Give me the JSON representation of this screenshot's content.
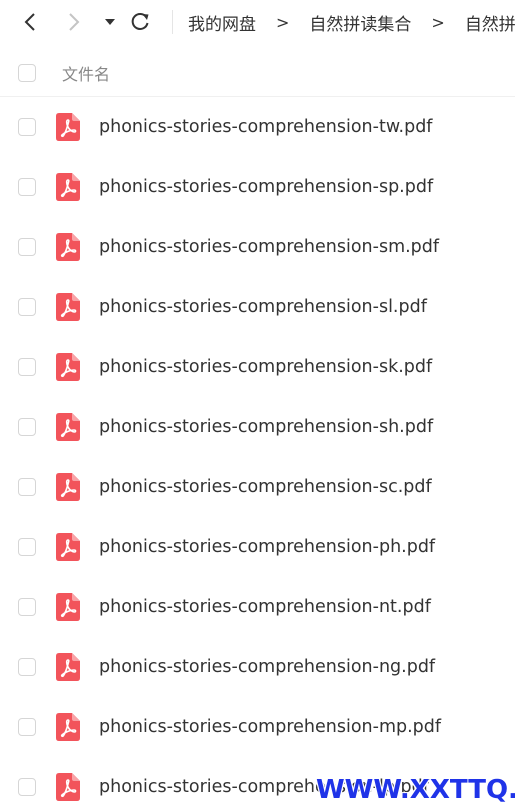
{
  "toolbar": {
    "breadcrumbs": [
      "我的网盘",
      "自然拼读集合",
      "自然拼"
    ],
    "separator": ">"
  },
  "header": {
    "column_label": "文件名"
  },
  "files": [
    {
      "name": "phonics-stories-comprehension-tw.pdf",
      "icon": "pdf-icon"
    },
    {
      "name": "phonics-stories-comprehension-sp.pdf",
      "icon": "pdf-icon"
    },
    {
      "name": "phonics-stories-comprehension-sm.pdf",
      "icon": "pdf-icon"
    },
    {
      "name": "phonics-stories-comprehension-sl.pdf",
      "icon": "pdf-icon"
    },
    {
      "name": "phonics-stories-comprehension-sk.pdf",
      "icon": "pdf-icon"
    },
    {
      "name": "phonics-stories-comprehension-sh.pdf",
      "icon": "pdf-icon"
    },
    {
      "name": "phonics-stories-comprehension-sc.pdf",
      "icon": "pdf-icon"
    },
    {
      "name": "phonics-stories-comprehension-ph.pdf",
      "icon": "pdf-icon"
    },
    {
      "name": "phonics-stories-comprehension-nt.pdf",
      "icon": "pdf-icon"
    },
    {
      "name": "phonics-stories-comprehension-ng.pdf",
      "icon": "pdf-icon"
    },
    {
      "name": "phonics-stories-comprehension-mp.pdf",
      "icon": "pdf-icon"
    },
    {
      "name": "phonics-stories-comprehension-lp.pdf",
      "icon": "pdf-icon"
    }
  ],
  "watermark": "WWW.XXTTQ.COM",
  "colors": {
    "pdf_red": "#f2545b",
    "watermark_blue": "#1f33e8",
    "text": "#333333",
    "muted": "#888888"
  }
}
